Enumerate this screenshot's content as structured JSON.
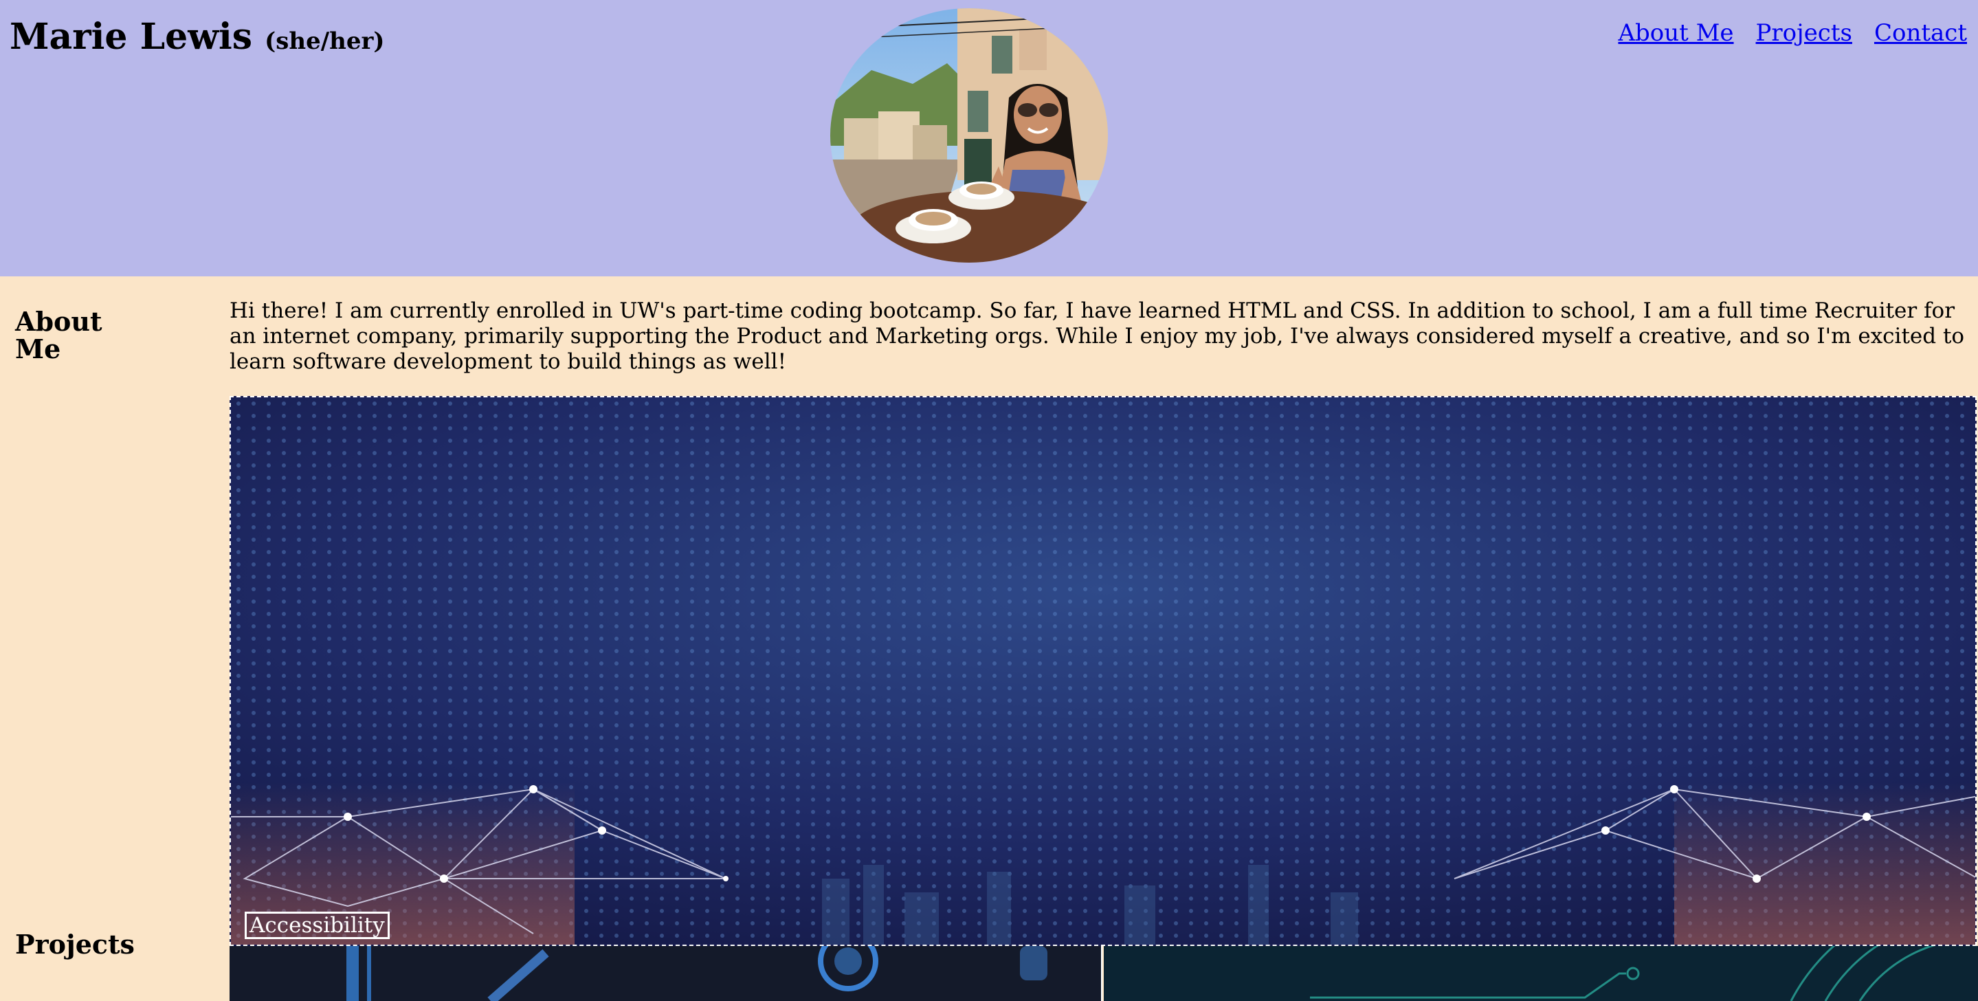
{
  "header": {
    "name": "Marie Lewis",
    "pronouns": "(she/her)",
    "background_color": "#b8b8ea"
  },
  "nav": {
    "items": [
      {
        "label": "About Me"
      },
      {
        "label": "Projects"
      },
      {
        "label": "Contact"
      }
    ],
    "link_color": "#0000ee"
  },
  "about": {
    "heading": "About Me",
    "text": "Hi there! I am currently enrolled in UW's part-time coding bootcamp. So far, I have learned HTML and CSS. In addition to school, I am a full time Recruiter for an internet company, primarily supporting the Product and Marketing orgs. While I enjoy my job, I've always considered myself a creative, and so I'm excited to learn software development to build things as well!"
  },
  "projects": {
    "heading": "Projects",
    "cards": [
      {
        "label": "Accessibility"
      }
    ]
  },
  "colors": {
    "page_background": "#fbe5c8"
  }
}
